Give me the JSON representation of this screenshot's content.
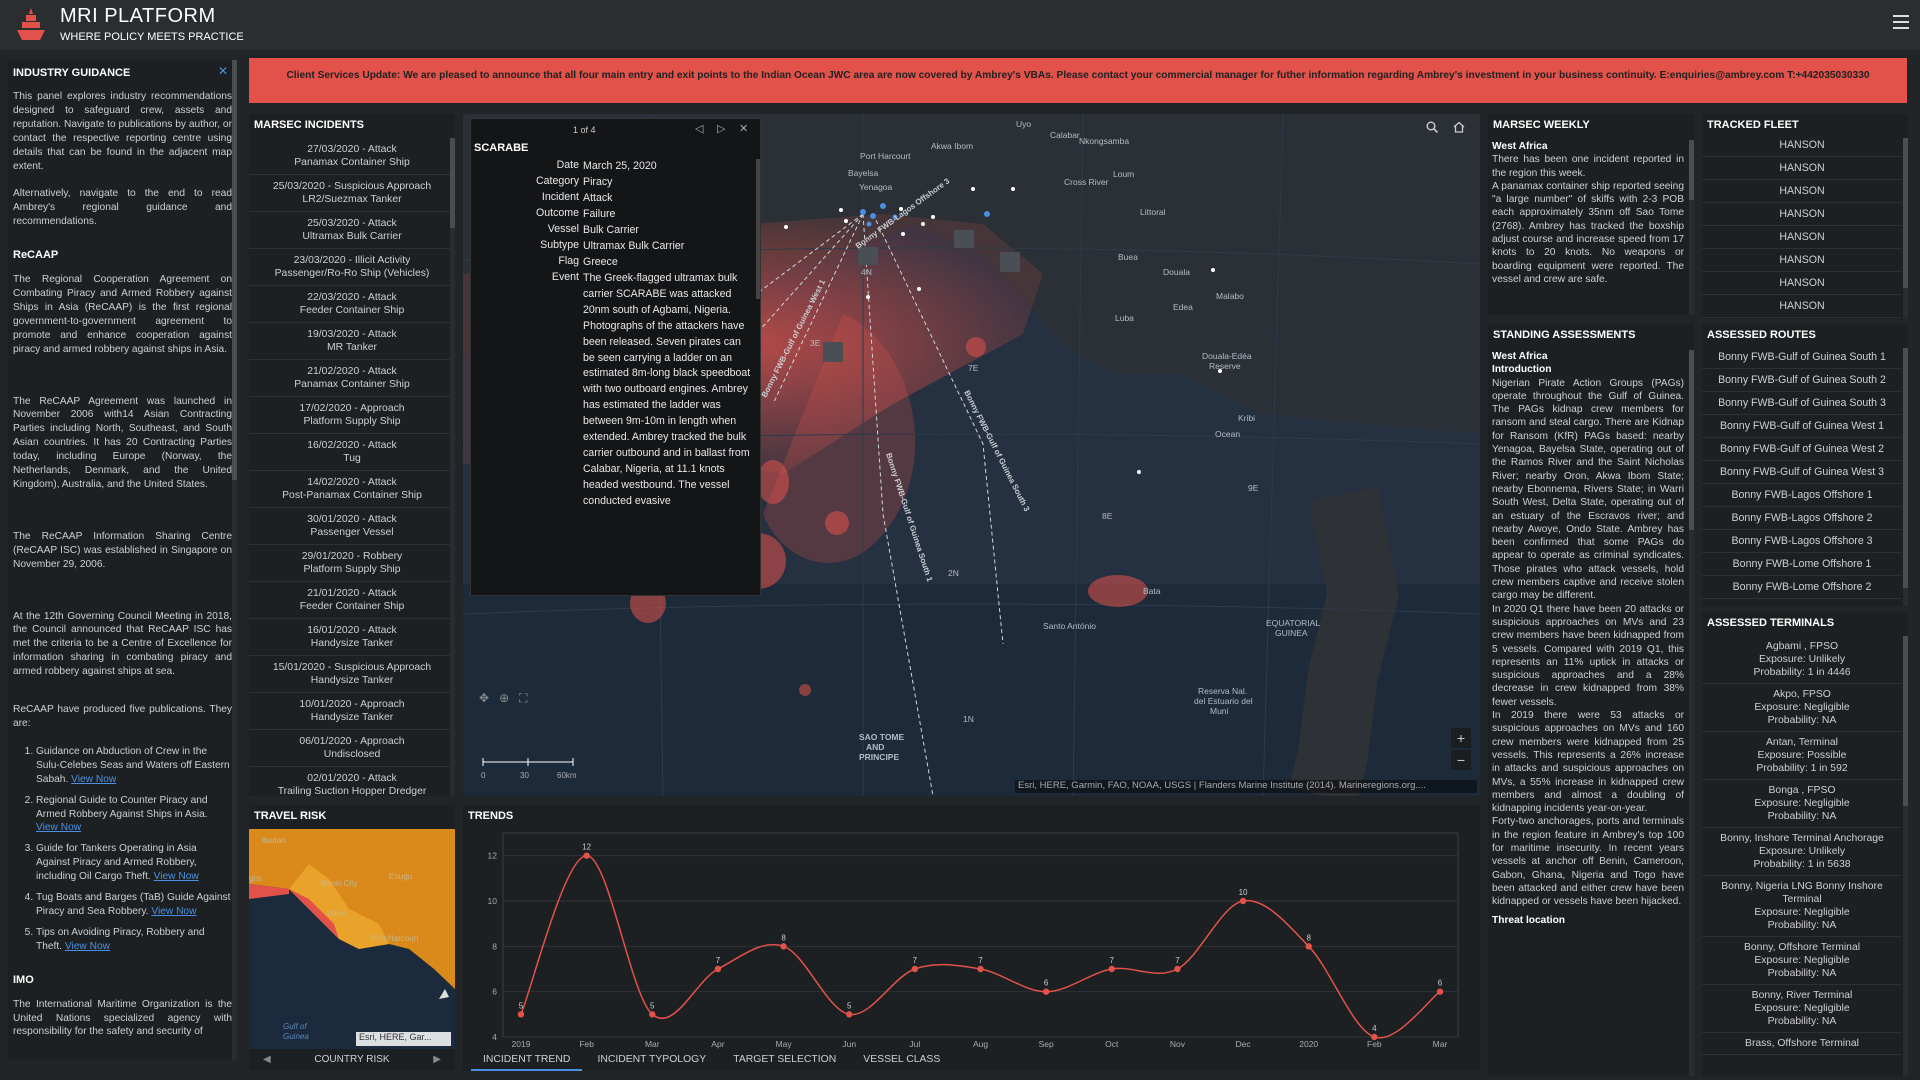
{
  "header": {
    "title": "MRI PLATFORM",
    "subtitle": "WHERE POLICY MEETS PRACTICE"
  },
  "banner": {
    "text": "Client Services Update: We are pleased to announce that all four main entry and exit points to the Indian Ocean JWC area are now covered by Ambrey's VBAs. Please contact your commercial manager for futher information regarding Ambrey's investment in your business continuity.  E:enquiries@ambrey.com T:+442035030330"
  },
  "guidance": {
    "title": "INDUSTRY GUIDANCE",
    "intro1": "This panel explores industry recommendations designed to safeguard crew, assets and reputation. Navigate to publications by author, or contact the respective reporting centre using details that can be found in the adjacent map extent.",
    "intro2": "Alternatively, navigate to the end to read Ambrey's regional guidance and recommendations.",
    "recaap_title": "ReCAAP",
    "recaap1": "The Regional Cooperation Agreement on Combating Piracy and Armed Robbery against Ships in Asia (ReCAAP) is the first regional government-to-government agreement to promote and enhance cooperation against piracy and armed robbery against ships in Asia.",
    "recaap2": "The ReCAAP Agreement was launched in November 2006 with14 Asian Contracting Parties including North, Southeast, and South Asian countries. It has 20 Contracting Parties today, including Europe (Norway, the Netherlands, Denmark, and the United Kingdom), Australia, and the United States.",
    "recaap3": "The ReCAAP Information Sharing Centre (ReCAAP ISC) was established in Singapore on November 29, 2006.",
    "recaap4": "At the 12th Governing Council Meeting in 2018, the Council announced that ReCAAP ISC has met the criteria to be a Centre of Excellence for information sharing in combating piracy and armed robbery against ships at sea.",
    "recaap5": "ReCAAP have produced five publications. They are:",
    "pubs": [
      "Guidance on Abduction of Crew in the Sulu-Celebes Seas and Waters off Eastern Sabah.",
      "Regional Guide to Counter Piracy and Armed Robbery Against Ships in Asia.",
      "Guide for Tankers Operating in Asia Against Piracy and Armed Robbery, including Oil Cargo Theft.",
      "Tug Boats and Barges (TaB) Guide Against Piracy and Sea Robbery.",
      "Tips on Avoiding Piracy, Robbery and Theft."
    ],
    "view_now": "View Now",
    "imo_title": "IMO",
    "imo1": "The International Maritime Organization is the United Nations specialized agency with responsibility for the safety and security of"
  },
  "marsec": {
    "title": "MARSEC INCIDENTS",
    "items": [
      {
        "l1": "27/03/2020 - Attack",
        "l2": "Panamax Container Ship"
      },
      {
        "l1": "25/03/2020 - Suspicious Approach",
        "l2": "LR2/Suezmax Tanker"
      },
      {
        "l1": "25/03/2020 - Attack",
        "l2": "Ultramax Bulk Carrier"
      },
      {
        "l1": "23/03/2020 - Illicit Activity",
        "l2": "Passenger/Ro-Ro Ship (Vehicles)"
      },
      {
        "l1": "22/03/2020 - Attack",
        "l2": "Feeder Container Ship"
      },
      {
        "l1": "19/03/2020 - Attack",
        "l2": "MR Tanker"
      },
      {
        "l1": "21/02/2020 - Attack",
        "l2": "Panamax Container Ship"
      },
      {
        "l1": "17/02/2020 - Approach",
        "l2": "Platform Supply Ship"
      },
      {
        "l1": "16/02/2020 - Attack",
        "l2": "Tug"
      },
      {
        "l1": "14/02/2020 - Attack",
        "l2": "Post-Panamax Container Ship"
      },
      {
        "l1": "30/01/2020 - Attack",
        "l2": "Passenger Vessel"
      },
      {
        "l1": "29/01/2020 - Robbery",
        "l2": "Platform Supply Ship"
      },
      {
        "l1": "21/01/2020 - Attack",
        "l2": "Feeder Container Ship"
      },
      {
        "l1": "16/01/2020 - Attack",
        "l2": "Handysize Tanker"
      },
      {
        "l1": "15/01/2020 - Suspicious Approach",
        "l2": "Handysize Tanker"
      },
      {
        "l1": "10/01/2020 - Approach",
        "l2": "Handysize Tanker"
      },
      {
        "l1": "06/01/2020 - Approach",
        "l2": "Undisclosed"
      },
      {
        "l1": "02/01/2020 - Attack",
        "l2": "Trailing Suction Hopper Dredger"
      }
    ]
  },
  "popup": {
    "nav": "1 of 4",
    "title": "SCARABE",
    "fields": [
      {
        "k": "Date",
        "v": "March 25, 2020"
      },
      {
        "k": "Category",
        "v": "Piracy"
      },
      {
        "k": "Incident",
        "v": "Attack"
      },
      {
        "k": "Outcome",
        "v": "Failure"
      },
      {
        "k": "Vessel",
        "v": "Bulk Carrier"
      },
      {
        "k": "Subtype",
        "v": "Ultramax Bulk Carrier"
      },
      {
        "k": "Flag",
        "v": "Greece"
      },
      {
        "k": "Event",
        "v": "The Greek-flagged ultramax bulk carrier SCARABE was attacked 20nm south of Agbami, Nigeria. Photographs of the attackers have been released. Seven pirates can be seen carrying a ladder on an estimated 8m-long black speedboat with two outboard engines. Ambrey has estimated the ladder was between 9m-10m in length when extended. Ambrey tracked the bulk carrier outbound and in ballast from Calabar, Nigeria, at 11.1 knots headed westbound. The vessel conducted evasive"
      }
    ]
  },
  "map": {
    "attribution": "Esri, HERE, Garmin, FAO, NOAA, USGS | Flanders Marine Institute (2014). Marineregions.org....",
    "labels": [
      "Yenagoa",
      "Port Harcourt",
      "Uyo",
      "Calabar",
      "Bayelsa",
      "Akwa Ibom",
      "Cross River",
      "Nkongsamba",
      "Loum",
      "Littoral",
      "Buea",
      "Douala",
      "Edea",
      "Malabo",
      "Luba",
      "Ocean",
      "Kribi",
      "Bata",
      "Santo António",
      "EQUATORIAL GUINEA",
      "Reserva Nal. del Estuario del Muni",
      "SAO TOME AND PRINCIPE",
      "Douala-Edéa Reserve"
    ],
    "grid_labels": [
      "4N",
      "3E",
      "7E",
      "8E",
      "9E",
      "6E",
      "2N",
      "1N"
    ],
    "routes": [
      "Bonny FWB-Lagos Offshore 3",
      "Bonny FWB-Gulf of Guinea West 1",
      "Bonny FWB-Gulf of Guinea South 1",
      "Bonny FWB-Gulf of Guinea South 3"
    ],
    "scale": [
      "0",
      "30",
      "60km"
    ]
  },
  "travel": {
    "title": "TRAVEL RISK",
    "tab": "COUNTRY RISK",
    "labels": [
      "Ibadan",
      "Lagos",
      "Benin City",
      "Enugu",
      "Warri",
      "Port Harcourt",
      "Gulf of Guinea"
    ],
    "attribution": "Esri, HERE, Gar..."
  },
  "trends": {
    "title": "TRENDS",
    "tabs": [
      "INCIDENT TREND",
      "INCIDENT TYPOLOGY",
      "TARGET SELECTION",
      "VESSEL CLASS"
    ]
  },
  "chart_data": {
    "type": "line",
    "title": "",
    "xlabel": "",
    "ylabel": "",
    "categories": [
      "2019",
      "Feb",
      "Mar",
      "Apr",
      "May",
      "Jun",
      "Jul",
      "Aug",
      "Sep",
      "Oct",
      "Nov",
      "Dec",
      "2020",
      "Feb",
      "Mar"
    ],
    "series": [
      {
        "values": [
          5,
          12,
          5,
          7,
          8,
          5,
          7,
          7,
          6,
          7,
          7,
          10,
          8,
          4,
          6
        ]
      }
    ],
    "ylim": [
      4,
      13
    ],
    "yticks": [
      4,
      6,
      8,
      10,
      12
    ],
    "grid": true,
    "colors": {
      "line": "#e2524a",
      "point": "#e2524a"
    }
  },
  "weekly": {
    "title": "MARSEC WEEKLY",
    "heading": "West Africa",
    "text1": "There has been one incident reported in the region this week.",
    "text2": "A panamax container ship reported seeing \"a large number\" of skiffs with 2-3 POB each approximately 35nm off Sao Tome (2768). Ambrey has tracked the boxship adjust course and increase speed from 17 knots to 20 knots. No weapons or boarding equipment were reported. The vessel and crew are safe."
  },
  "standing": {
    "title": "STANDING ASSESSMENTS",
    "heading": "West Africa",
    "sub": "Introduction",
    "p1": "Nigerian Pirate Action Groups (PAGs) operate throughout the Gulf of Guinea. The PAGs kidnap crew members for ransom and steal cargo. There are Kidnap for Ransom (KfR) PAGs based: nearby Yenagoa, Bayelsa State, operating out of the Ramos River and the Saint Nicholas River; nearby Oron, Akwa Ibom State; nearby Ebonnema, Rivers State; in Warri South West, Delta State, operating out of an estuary of the Escravos river; and nearby Awoye, Ondo State. Ambrey has been confirmed that some PAGs do appear to operate as criminal syndicates. Those pirates who attack vessels, hold crew members captive and receive stolen cargo may be different.",
    "p2": "In 2020 Q1 there have been 20 attacks or suspicious approaches on MVs and 23 crew members have been kidnapped from 5 vessels. Compared with 2019 Q1, this represents an 11% uptick in attacks or suspicious approaches and a 28% decrease in crew kidnapped from 38% fewer vessels.",
    "p3": "In 2019 there were 53 attacks or suspicious approaches on MVs and 160 crew members were kidnapped from 25 vessels. This represents a 26% increase in attacks and suspicious approaches on MVs, a 55% increase in kidnapped crew members and almost a doubling of kidnapping incidents year-on-year.",
    "p4": "Forty-two anchorages, ports and terminals in the region feature in Ambrey's top 100 for maritime insecurity. In recent years vessels at anchor off Benin, Cameroon, Gabon, Ghana, Nigeria and Togo have been attacked and either crew have been kidnapped or vessels have been hijacked.",
    "threat": "Threat location"
  },
  "fleet": {
    "title": "TRACKED FLEET",
    "items": [
      "HANSON",
      "HANSON",
      "HANSON",
      "HANSON",
      "HANSON",
      "HANSON",
      "HANSON",
      "HANSON"
    ]
  },
  "routes": {
    "title": "ASSESSED ROUTES",
    "items": [
      "Bonny FWB-Gulf of Guinea South 1",
      "Bonny FWB-Gulf of Guinea South 2",
      "Bonny FWB-Gulf of Guinea South 3",
      "Bonny FWB-Gulf of Guinea West 1",
      "Bonny FWB-Gulf of Guinea West 2",
      "Bonny FWB-Gulf of Guinea West 3",
      "Bonny FWB-Lagos Offshore 1",
      "Bonny FWB-Lagos Offshore 2",
      "Bonny FWB-Lagos Offshore 3",
      "Bonny FWB-Lome Offshore 1",
      "Bonny FWB-Lome Offshore 2"
    ]
  },
  "terminals": {
    "title": "ASSESSED TERMINALS",
    "items": [
      {
        "name": "Agbami , FPSO",
        "exp": "Exposure: Unlikely",
        "prob": "Probability: 1 in 4446"
      },
      {
        "name": "Akpo, FPSO",
        "exp": "Exposure: Negligible",
        "prob": "Probability: NA"
      },
      {
        "name": "Antan, Terminal",
        "exp": "Exposure: Possible",
        "prob": "Probability: 1 in 592"
      },
      {
        "name": "Bonga , FPSO",
        "exp": "Exposure: Negligible",
        "prob": "Probability: NA"
      },
      {
        "name": "Bonny, Inshore Terminal Anchorage",
        "exp": "Exposure: Unlikely",
        "prob": "Probability: 1 in 5638"
      },
      {
        "name": "Bonny, Nigeria LNG Bonny Inshore Terminal",
        "exp": "Exposure: Negligible",
        "prob": "Probability: NA"
      },
      {
        "name": "Bonny, Offshore Terminal",
        "exp": "Exposure: Negligible",
        "prob": "Probability: NA"
      },
      {
        "name": "Bonny, River Terminal",
        "exp": "Exposure: Negligible",
        "prob": "Probability: NA"
      },
      {
        "name": "Brass, Offshore Terminal",
        "exp": "",
        "prob": ""
      }
    ]
  }
}
